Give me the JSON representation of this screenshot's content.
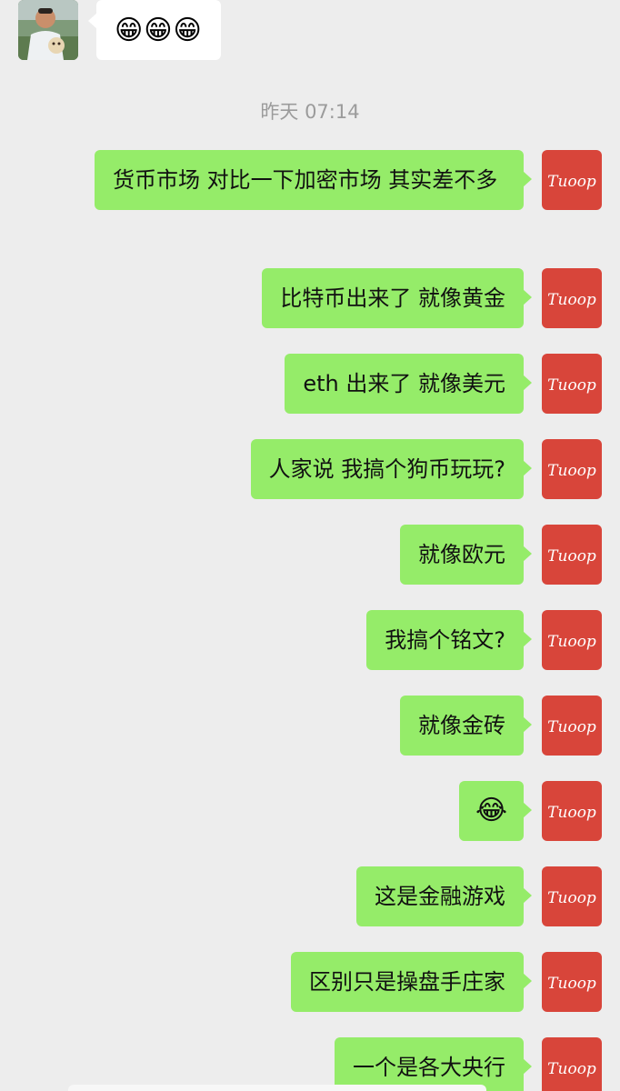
{
  "incoming": {
    "emoji_text": "😁😁😁"
  },
  "timestamp": "昨天 07:14",
  "outgoing": [
    {
      "text": "货币市场 对比一下加密市场 其实差不多"
    },
    {
      "text": "比特币出来了 就像黄金"
    },
    {
      "text": "eth 出来了 就像美元"
    },
    {
      "text": "人家说 我搞个狗币玩玩?"
    },
    {
      "text": "就像欧元"
    },
    {
      "text": "我搞个铭文?"
    },
    {
      "text": "就像金砖"
    },
    {
      "text": "😂"
    },
    {
      "text": "这是金融游戏"
    },
    {
      "text": "区别只是操盘手庄家"
    },
    {
      "text": "一个是各大央行"
    }
  ],
  "avatar": {
    "logo_text": "Tuoop",
    "color": "#d8453a"
  },
  "colors": {
    "background": "#ededed",
    "outgoing_bubble": "#95ec69",
    "incoming_bubble": "#ffffff",
    "timestamp_text": "#9b9b9b"
  },
  "icons": {
    "peer_avatar": "avatar-photo",
    "my_avatar": "tuoop-logo-avatar"
  }
}
